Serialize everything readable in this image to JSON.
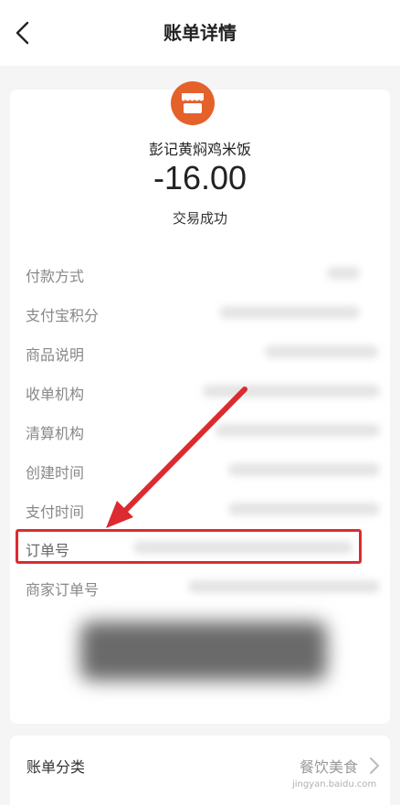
{
  "nav": {
    "title": "账单详情"
  },
  "merchant": {
    "name": "彭记黄焖鸡米饭",
    "amount": "-16.00",
    "status": "交易成功"
  },
  "details": {
    "rows": [
      {
        "label": "付款方式"
      },
      {
        "label": "支付宝积分"
      },
      {
        "label": "商品说明"
      },
      {
        "label": "收单机构"
      },
      {
        "label": "清算机构"
      },
      {
        "label": "创建时间"
      },
      {
        "label": "支付时间"
      },
      {
        "label": "订单号"
      },
      {
        "label": "商家订单号"
      }
    ]
  },
  "category": {
    "label": "账单分类",
    "value": "餐饮美食"
  },
  "watermark": "jingyan.baidu.com",
  "colors": {
    "accent": "#e5612a",
    "highlight": "#dc2b30"
  }
}
